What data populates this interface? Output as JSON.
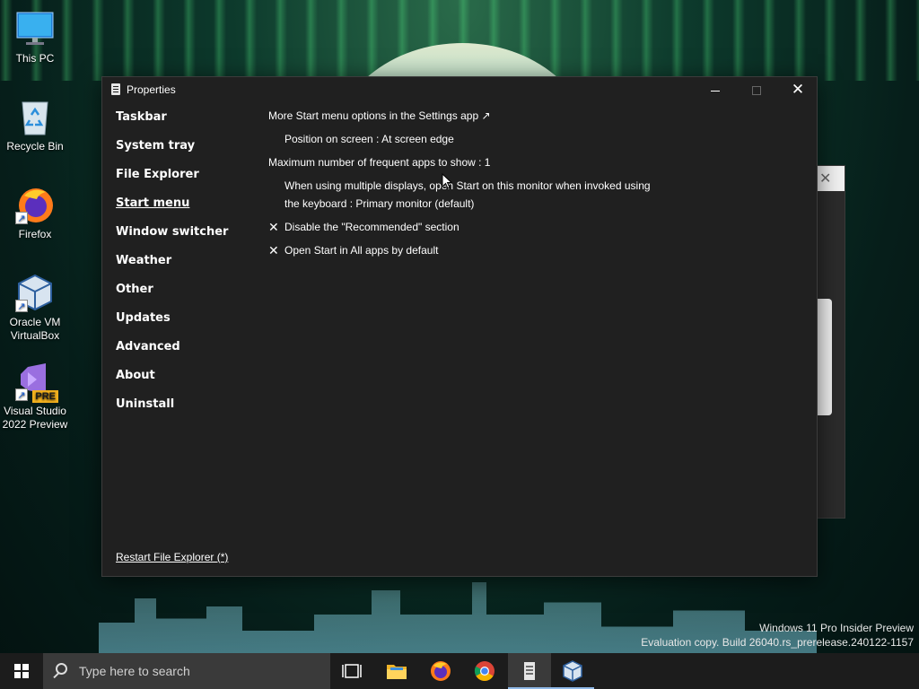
{
  "desktop": {
    "icons": [
      {
        "label": "This PC"
      },
      {
        "label": "Recycle Bin"
      },
      {
        "label": "Firefox"
      },
      {
        "label": "Oracle VM VirtualBox"
      },
      {
        "label": "Visual Studio 2022 Preview",
        "badge": "PRE"
      }
    ],
    "watermark": {
      "line1": "Windows 11 Pro Insider Preview",
      "line2": "Evaluation copy. Build 26040.rs_prerelease.240122-1157"
    }
  },
  "window": {
    "title": "Properties",
    "title_icon": "properties-icon",
    "close_glyph": "✕"
  },
  "sidebar": {
    "items": [
      {
        "label": "Taskbar"
      },
      {
        "label": "System tray"
      },
      {
        "label": "File Explorer"
      },
      {
        "label": "Start menu",
        "active": true
      },
      {
        "label": "Window switcher"
      },
      {
        "label": "Weather"
      },
      {
        "label": "Other"
      },
      {
        "label": "Updates"
      },
      {
        "label": "Advanced"
      },
      {
        "label": "About"
      },
      {
        "label": "Uninstall"
      }
    ],
    "restart_link": "Restart File Explorer (*)"
  },
  "content": {
    "settings_link": "More Start menu options in the Settings app ↗",
    "position": "Position on screen : At screen edge",
    "max_frequent": "Maximum number of frequent apps to show : 1",
    "multi_display_line1": "When using multiple displays, open Start on this monitor when invoked using",
    "multi_display_line2": "the keyboard : Primary monitor (default)",
    "disable_recommended": "Disable the \"Recommended\" section",
    "open_all_apps": "Open Start in All apps by default",
    "check_glyph": "✕"
  },
  "taskbar": {
    "search_placeholder": "Type here to search",
    "pinned": [
      "task-view-icon",
      "file-explorer-icon",
      "firefox-icon",
      "chrome-icon",
      "properties-app-icon",
      "virtualbox-icon"
    ],
    "active": "properties-app-icon"
  },
  "colors": {
    "window_bg": "#202020",
    "taskbar_bg": "#1c1c1c",
    "search_bg": "#3a3a3a",
    "accent": "#8fb8e6"
  }
}
